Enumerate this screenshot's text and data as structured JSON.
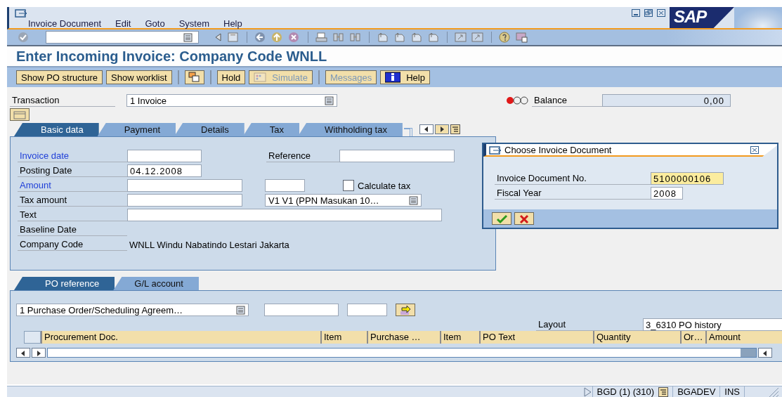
{
  "window": {
    "logo": "SAP",
    "menu": [
      {
        "label": "Invoice Document"
      },
      {
        "label": "Edit"
      },
      {
        "label": "Goto"
      },
      {
        "label": "System"
      },
      {
        "label": "Help"
      }
    ]
  },
  "title": "Enter Incoming Invoice: Company Code WNLL",
  "app_toolbar": [
    {
      "kind": "button",
      "label": "Show PO structure",
      "disabled": false
    },
    {
      "kind": "button",
      "label": "Show worklist",
      "disabled": false
    },
    {
      "kind": "separator"
    },
    {
      "kind": "icon_only",
      "disabled": false
    },
    {
      "kind": "separator"
    },
    {
      "kind": "button",
      "label": "Hold",
      "disabled": false
    },
    {
      "kind": "icon_button",
      "label": "Simulate",
      "disabled": true
    },
    {
      "kind": "separator"
    },
    {
      "kind": "button",
      "label": "Messages",
      "disabled": true
    },
    {
      "kind": "icon_button",
      "label": "Help",
      "disabled": false
    }
  ],
  "transaction": {
    "label": "Transaction",
    "value": "1 Invoice"
  },
  "balance": {
    "label": "Balance",
    "value": "0,00"
  },
  "header_tabs": [
    {
      "label": "Basic data",
      "selected": true
    },
    {
      "label": "Payment",
      "selected": false
    },
    {
      "label": "Details",
      "selected": false
    },
    {
      "label": "Tax",
      "selected": false
    },
    {
      "label": "Withholding tax",
      "selected": false
    }
  ],
  "basic_data": {
    "invoice_date": {
      "label": "Invoice date",
      "emphasized": true
    },
    "reference": {
      "label": "Reference"
    },
    "posting_date": {
      "label": "Posting Date",
      "emphasized": false,
      "value": "04.12.2008"
    },
    "amount": {
      "label": "Amount",
      "emphasized": true
    },
    "calculate_tax": {
      "label": "Calculate tax",
      "checked": false
    },
    "tax_amount": {
      "label": "Tax amount",
      "emphasized": false
    },
    "tax_code": {
      "value": "V1 V1 (PPN Masukan 10…"
    },
    "text": {
      "label": "Text",
      "emphasized": false
    },
    "baseline_date": {
      "label": "Baseline Date",
      "emphasized": false
    },
    "company_code": {
      "label": "Company Code",
      "emphasized": false,
      "value": "WNLL Windu Nabatindo Lestari Jakarta"
    }
  },
  "dialog": {
    "title": "Choose Invoice Document",
    "fields": [
      {
        "label": "Invoice Document No.",
        "value": "5100000106",
        "focused": true
      },
      {
        "label": "Fiscal Year",
        "value": "2008",
        "focused": false
      }
    ]
  },
  "item_tabs": [
    {
      "label": "PO reference",
      "selected": true
    },
    {
      "label": "G/L account",
      "selected": false
    }
  ],
  "po_reference": {
    "selection": "1 Purchase Order/Scheduling Agreem…",
    "layout": {
      "label": "Layout",
      "value": "3_6310 PO history"
    },
    "columns": [
      "Procurement Doc.",
      "Item",
      "Purchase …",
      "Item",
      "PO Text",
      "Quantity",
      "Or…",
      "Amount"
    ]
  },
  "status_bar": {
    "session": "BGD (1) (310)",
    "server": "BGADEV",
    "mode": "INS"
  }
}
